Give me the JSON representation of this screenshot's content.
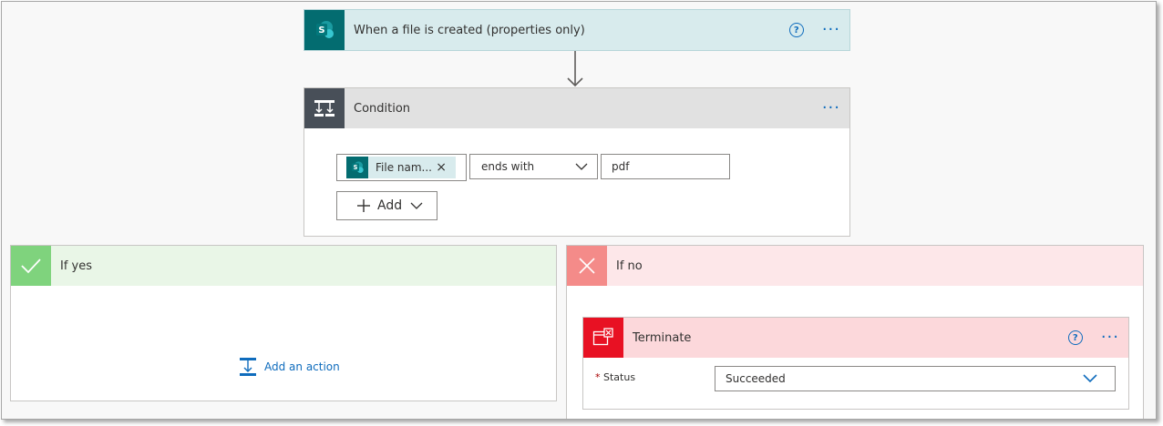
{
  "trigger": {
    "title": "When a file is created (properties only)",
    "icon": "sharepoint-icon",
    "help_label": "?",
    "more_label": "···"
  },
  "condition": {
    "title": "Condition",
    "icon": "condition-icon",
    "more_label": "···",
    "token_label": "File nam...",
    "token_remove": "×",
    "operator": "ends with",
    "value": "pdf",
    "add_label": "Add"
  },
  "if_yes": {
    "title": "If yes",
    "add_action_label": "Add an action"
  },
  "if_no": {
    "title": "If no",
    "terminate": {
      "title": "Terminate",
      "help_label": "?",
      "more_label": "···",
      "status_required": "*",
      "status_label": "Status",
      "status_value": "Succeeded"
    }
  },
  "colors": {
    "trigger_header": "#d8ebed",
    "sharepoint": "#036c70",
    "condition_header": "#e1e1e1",
    "condition_icon_bg": "#484f58",
    "yes_header": "#e9f6e7",
    "yes_icon_bg": "#7fd37d",
    "no_header": "#fde7e9",
    "no_icon_bg": "#f48b89",
    "terminate_header": "#fcd8db",
    "terminate_icon_bg": "#e81123",
    "accent": "#0f6cbd"
  }
}
